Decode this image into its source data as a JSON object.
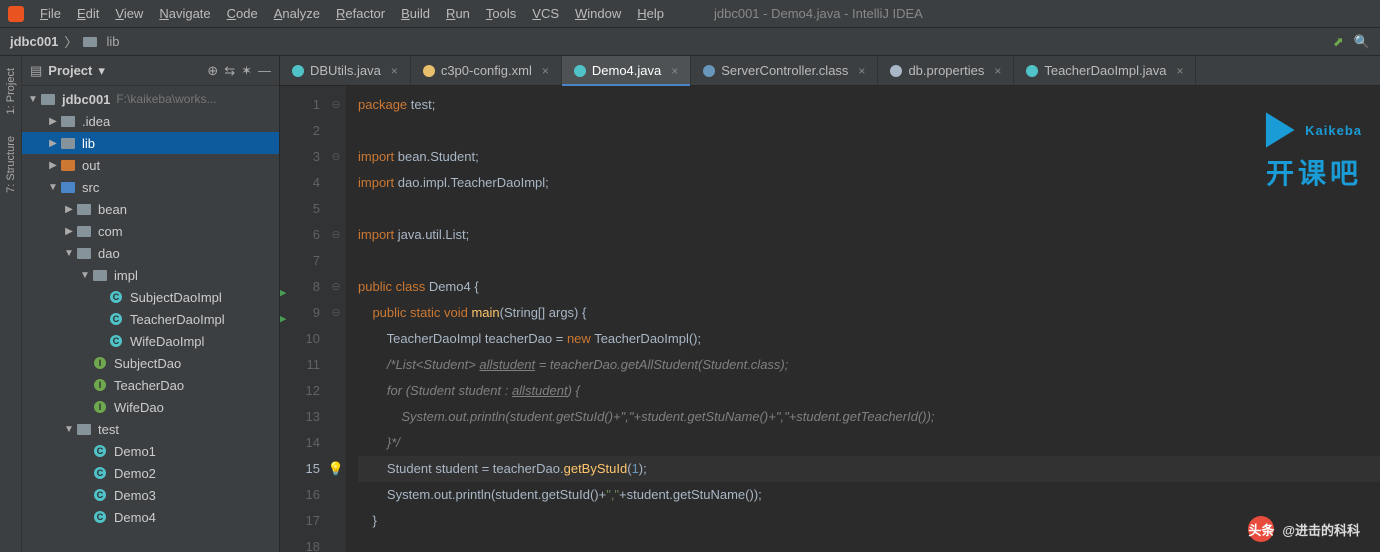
{
  "window": {
    "title": "jdbc001 - Demo4.java - IntelliJ IDEA"
  },
  "menu": [
    "File",
    "Edit",
    "View",
    "Navigate",
    "Code",
    "Analyze",
    "Refactor",
    "Build",
    "Run",
    "Tools",
    "VCS",
    "Window",
    "Help"
  ],
  "breadcrumb": {
    "project": "jdbc001",
    "path": "lib"
  },
  "project_panel": {
    "title": "Project",
    "root": {
      "name": "jdbc001",
      "hint": "F:\\kaikeba\\works..."
    },
    "tree": [
      {
        "depth": 1,
        "expand": "▶",
        "icon": "folder",
        "label": ".idea"
      },
      {
        "depth": 1,
        "expand": "▶",
        "icon": "folder",
        "label": "lib",
        "selected": true
      },
      {
        "depth": 1,
        "expand": "▶",
        "icon": "folder-orange",
        "label": "out"
      },
      {
        "depth": 1,
        "expand": "▼",
        "icon": "folder-blue",
        "label": "src"
      },
      {
        "depth": 2,
        "expand": "▶",
        "icon": "folder",
        "label": "bean"
      },
      {
        "depth": 2,
        "expand": "▶",
        "icon": "folder",
        "label": "com"
      },
      {
        "depth": 2,
        "expand": "▼",
        "icon": "folder",
        "label": "dao"
      },
      {
        "depth": 3,
        "expand": "▼",
        "icon": "folder",
        "label": "impl"
      },
      {
        "depth": 4,
        "expand": "",
        "icon": "class-c",
        "label": "SubjectDaoImpl"
      },
      {
        "depth": 4,
        "expand": "",
        "icon": "class-c",
        "label": "TeacherDaoImpl"
      },
      {
        "depth": 4,
        "expand": "",
        "icon": "class-c",
        "label": "WifeDaoImpl"
      },
      {
        "depth": 3,
        "expand": "",
        "icon": "iface-i",
        "label": "SubjectDao"
      },
      {
        "depth": 3,
        "expand": "",
        "icon": "iface-i",
        "label": "TeacherDao"
      },
      {
        "depth": 3,
        "expand": "",
        "icon": "iface-i",
        "label": "WifeDao"
      },
      {
        "depth": 2,
        "expand": "▼",
        "icon": "folder",
        "label": "test"
      },
      {
        "depth": 3,
        "expand": "",
        "icon": "class-c",
        "label": "Demo1"
      },
      {
        "depth": 3,
        "expand": "",
        "icon": "class-c",
        "label": "Demo2"
      },
      {
        "depth": 3,
        "expand": "",
        "icon": "class-c",
        "label": "Demo3"
      },
      {
        "depth": 3,
        "expand": "",
        "icon": "class-c",
        "label": "Demo4"
      }
    ]
  },
  "side_tabs": {
    "project": "1: Project",
    "structure": "7: Structure"
  },
  "tabs": [
    {
      "label": "DBUtils.java",
      "kind": "class",
      "active": false
    },
    {
      "label": "c3p0-config.xml",
      "kind": "xml",
      "active": false
    },
    {
      "label": "Demo4.java",
      "kind": "class",
      "active": true
    },
    {
      "label": "ServerController.class",
      "kind": "decompiled",
      "active": false
    },
    {
      "label": "db.properties",
      "kind": "props",
      "active": false
    },
    {
      "label": "TeacherDaoImpl.java",
      "kind": "class",
      "active": false
    }
  ],
  "editor": {
    "current_line": 15,
    "run_markers": [
      8,
      9
    ],
    "bulb_line": 15,
    "lines": [
      {
        "n": 1,
        "tokens": [
          [
            "kw",
            "package "
          ],
          [
            "",
            "test;"
          ]
        ]
      },
      {
        "n": 2,
        "tokens": []
      },
      {
        "n": 3,
        "tokens": [
          [
            "kw",
            "import "
          ],
          [
            "",
            "bean.Student;"
          ]
        ]
      },
      {
        "n": 4,
        "tokens": [
          [
            "kw",
            "import "
          ],
          [
            "",
            "dao.impl.TeacherDaoImpl;"
          ]
        ]
      },
      {
        "n": 5,
        "tokens": []
      },
      {
        "n": 6,
        "tokens": [
          [
            "kw",
            "import "
          ],
          [
            "",
            "java.util.List;"
          ]
        ]
      },
      {
        "n": 7,
        "tokens": []
      },
      {
        "n": 8,
        "tokens": [
          [
            "kw",
            "public class "
          ],
          [
            "",
            "Demo4 {"
          ]
        ]
      },
      {
        "n": 9,
        "tokens": [
          [
            "",
            "    "
          ],
          [
            "kw",
            "public static void "
          ],
          [
            "fn",
            "main"
          ],
          [
            "",
            "(String[] args) {"
          ]
        ]
      },
      {
        "n": 10,
        "tokens": [
          [
            "",
            "        TeacherDaoImpl teacherDao = "
          ],
          [
            "kw",
            "new "
          ],
          [
            "",
            "TeacherDaoImpl();"
          ]
        ]
      },
      {
        "n": 11,
        "tokens": [
          [
            "",
            "        "
          ],
          [
            "cm",
            "/*List<Student> "
          ],
          [
            "cm underline",
            "allstudent"
          ],
          [
            "cm",
            " = teacherDao.getAllStudent(Student.class);"
          ]
        ]
      },
      {
        "n": 12,
        "tokens": [
          [
            "",
            "        "
          ],
          [
            "cm",
            "for (Student student : "
          ],
          [
            "cm underline",
            "allstudent"
          ],
          [
            "cm",
            ") {"
          ]
        ]
      },
      {
        "n": 13,
        "tokens": [
          [
            "",
            "            "
          ],
          [
            "cm",
            "System.out.println(student.getStuId()+\",\"+student.getStuName()+\",\"+student.getTeacherId());"
          ]
        ]
      },
      {
        "n": 14,
        "tokens": [
          [
            "",
            "        "
          ],
          [
            "cm",
            "}*/"
          ]
        ]
      },
      {
        "n": 15,
        "tokens": [
          [
            "",
            "        Student student = teacherDao."
          ],
          [
            "fn",
            "getByStuId"
          ],
          [
            "",
            "("
          ],
          [
            "num",
            "1"
          ],
          [
            "",
            ");"
          ]
        ]
      },
      {
        "n": 16,
        "tokens": [
          [
            "",
            "        System."
          ],
          [
            "",
            "out"
          ],
          [
            "",
            ".println(student.getStuId()+"
          ],
          [
            "str",
            "\",\""
          ],
          [
            "",
            "+student.getStuName());"
          ]
        ]
      },
      {
        "n": 17,
        "tokens": [
          [
            "",
            "    }"
          ]
        ]
      },
      {
        "n": 18,
        "tokens": []
      }
    ]
  },
  "watermark": {
    "brand": "Kaikeba",
    "sub": "开课吧"
  },
  "attribution": {
    "prefix": "头条",
    "author": "@进击的科科"
  }
}
